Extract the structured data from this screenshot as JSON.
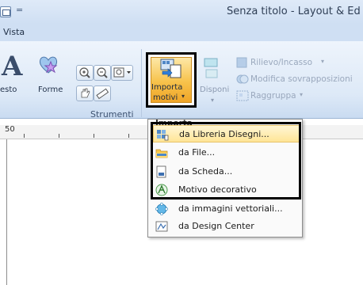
{
  "titlebar": {
    "title": "Senza titolo - Layout & Ed",
    "qat_separator": "="
  },
  "tabs": {
    "vista": "Vista"
  },
  "ribbon": {
    "text_button_label": "esto",
    "forme_label": "Forme",
    "strumenti_group_label": "Strumenti",
    "importa_label_line1": "Importa",
    "importa_label_line2": "motivi",
    "disponi_label": "Disponi",
    "importa_group_label": "Importa",
    "rilievo_label": "Rilievo/Incasso",
    "modifica_label": "Modifica sovrapposizioni",
    "raggruppa_label": "Raggruppa"
  },
  "ruler": {
    "label": "50"
  },
  "import_menu": {
    "items": [
      {
        "label": "da Libreria Disegni...",
        "icon": "library-designs-icon"
      },
      {
        "label": "da File...",
        "icon": "folder-icon"
      },
      {
        "label": "da Scheda...",
        "icon": "card-icon"
      },
      {
        "label": "Motivo decorativo",
        "icon": "decorative-pattern-icon"
      },
      {
        "label": "da immagini vettoriali...",
        "icon": "vector-images-icon"
      },
      {
        "label": "da Design Center",
        "icon": "design-center-icon"
      }
    ]
  },
  "colors": {
    "highlight_outline": "#000000",
    "hover": "#ffe596",
    "ribbon": "#dde9f7"
  }
}
